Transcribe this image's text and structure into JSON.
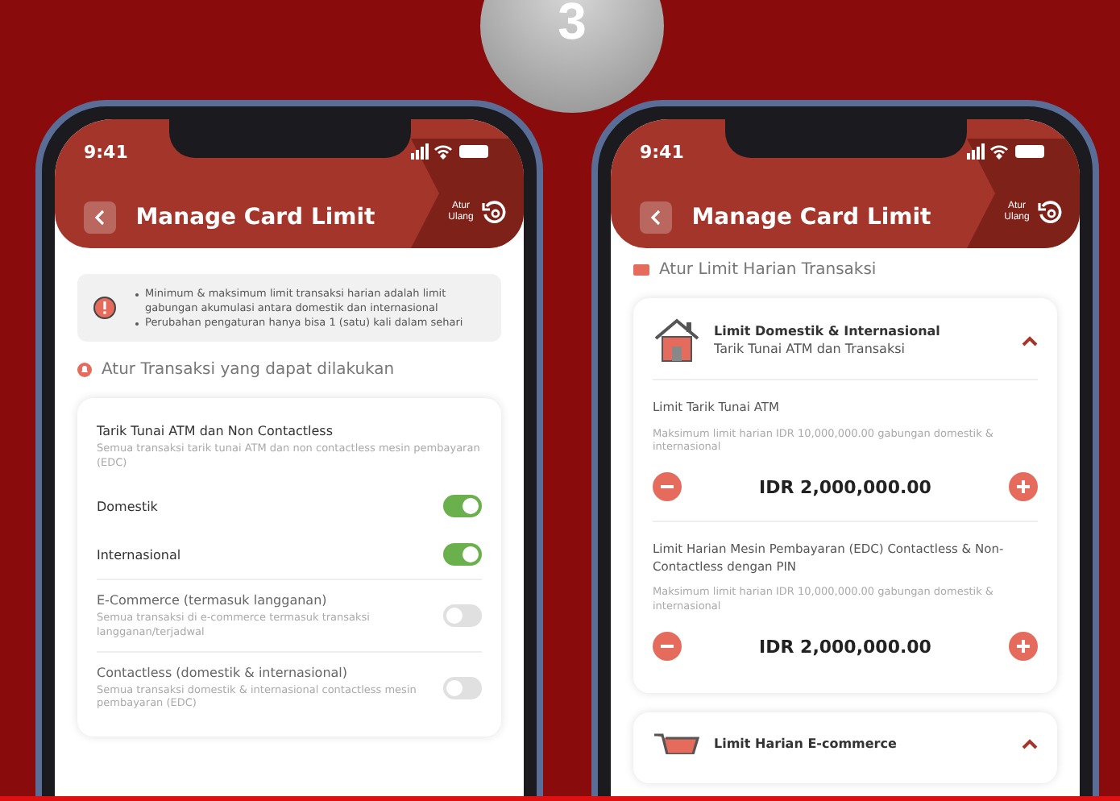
{
  "step_badge": "3",
  "phones": [
    {
      "time": "9:41",
      "title": "Manage Card Limit",
      "reset_label": "Atur Ulang",
      "kind": "settings",
      "info": [
        "Minimum & maksimum limit transaksi harian adalah limit gabungan akumulasi antara domestik dan internasional",
        "Perubahan pengaturan hanya bisa 1 (satu) kali dalam sehari"
      ],
      "section": "Atur Transaksi yang dapat dilakukan",
      "items": [
        {
          "kind": "group",
          "title": "Tarik Tunai ATM dan Non Contactless",
          "desc": "Semua transaksi tarik tunai ATM dan non contactless mesin pembayaran (EDC)"
        },
        {
          "kind": "toggle",
          "title": "Domestik",
          "on": true
        },
        {
          "kind": "toggle",
          "title": "Internasional",
          "on": true
        },
        {
          "kind": "toggle",
          "title": "E-Commerce (termasuk langganan)",
          "desc": "Semua transaksi di e-commerce termasuk transaksi langganan/terjadwal",
          "on": false
        },
        {
          "kind": "toggle",
          "title": "Contactless (domestik & internasional)",
          "desc": "Semua transaksi domestik & internasional contactless mesin pembayaran (EDC)",
          "on": false
        }
      ]
    },
    {
      "time": "9:41",
      "title": "Manage Card Limit",
      "reset_label": "Atur Ulang",
      "kind": "limits",
      "section": "Atur Limit Harian Transaksi",
      "cards": [
        {
          "title": "Limit Domestik & Internasional",
          "subtitle": "Tarik Tunai ATM dan Transaksi",
          "expanded": true,
          "limits": [
            {
              "label": "Limit Tarik Tunai ATM",
              "note": "Maksimum limit harian IDR 10,000,000.00 gabungan domestik & internasional",
              "amount": "IDR 2,000,000.00"
            },
            {
              "label": "Limit Harian Mesin Pembayaran (EDC) Contactless & Non-Contactless dengan PIN",
              "note": "Maksimum limit harian IDR 10,000,000.00 gabungan domestik & internasional",
              "amount": "IDR 2,000,000.00"
            }
          ]
        },
        {
          "title": "Limit Harian E-commerce",
          "expanded": true
        }
      ]
    }
  ]
}
